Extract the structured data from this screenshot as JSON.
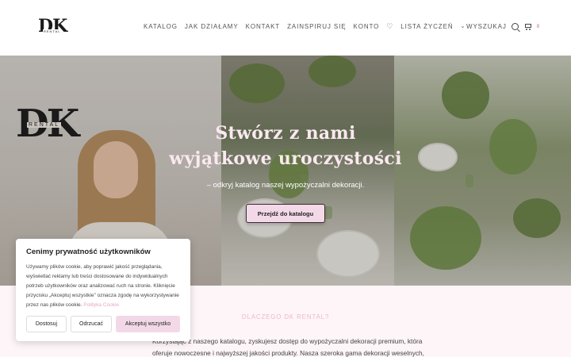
{
  "header": {
    "logo_text": "DK",
    "logo_sub": "RENTAL",
    "nav": [
      "KATALOG",
      "JAK DZIAŁAMY",
      "KONTAKT",
      "ZAINSPIRUJ SIĘ",
      "KONTO"
    ],
    "wishlist_label": "LISTA ŻYCZEŃ",
    "search_label": "WYSZUKAJ",
    "cart_count": "0"
  },
  "hero": {
    "logo_text": "DK",
    "logo_sub": "RENTAL",
    "title_line1": "Stwórz z nami",
    "title_line2": "wyjątkowe uroczystości",
    "subtitle": "– odkryj katalog naszej wypożyczalni dekoracji.",
    "button_label": "Przejdź do katalogu"
  },
  "section": {
    "heading": "DLACZEGO DK RENTAL?",
    "paragraph": "Korzystając z naszego katalogu, zyskujesz dostęp do wypożyczalni dekoracji premium, która oferuje nowoczesne i najwyższej jakości produkty. Nasza szeroka gama dekoracji weselnych,"
  },
  "cookie": {
    "title": "Cenimy prywatność użytkowników",
    "text": "Używamy plików cookie, aby poprawić jakość przeglądania, wyświetlać reklamy lub treści dostosowane do indywidualnych potrzeb użytkowników oraz analizować ruch na stronie. Kliknięcie przycisku „Akceptuj wszystkie” oznacza zgodę na wykorzystywanie przez nas plików cookie.",
    "policy_link": "Polityka Cookie",
    "btn_customize": "Dostosuj",
    "btn_reject": "Odrzucać",
    "btn_accept": "Akceptuj wszystko"
  },
  "colors": {
    "accent_pink": "#f3d9e8",
    "link_pink": "#e7a6c6",
    "title_pink": "#fbe8f0"
  }
}
